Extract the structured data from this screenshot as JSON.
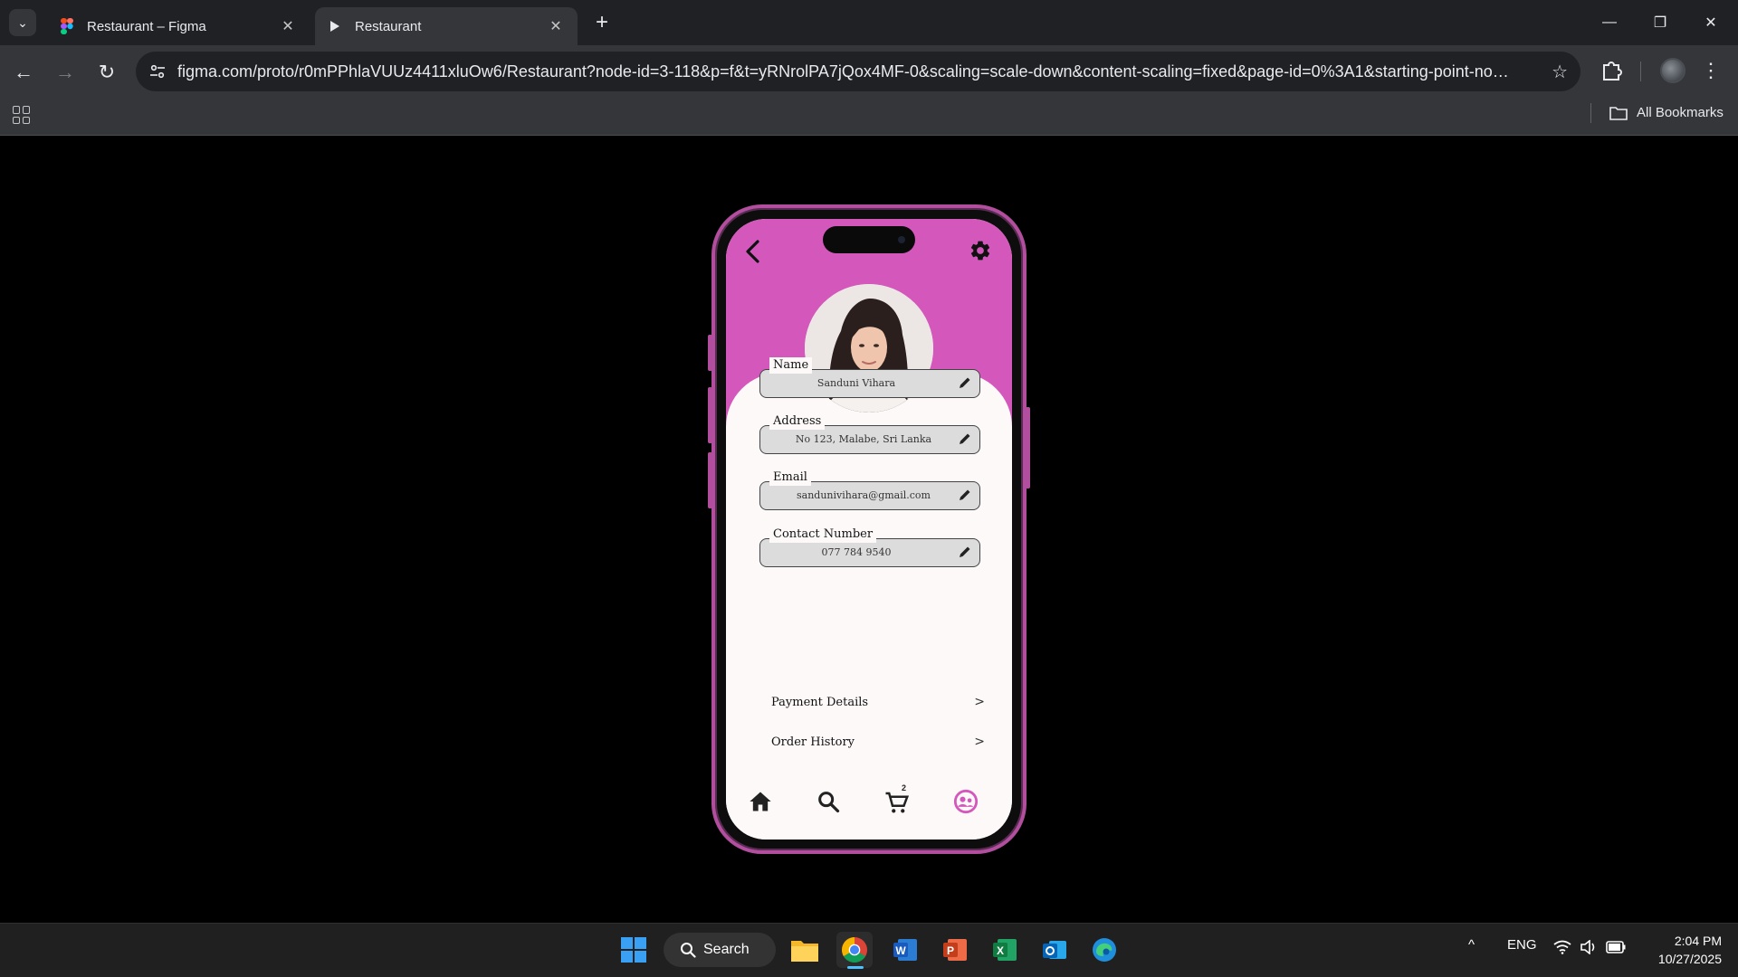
{
  "browser": {
    "tabs": [
      {
        "label": "Restaurant – Figma",
        "favicon": "figma-icon"
      },
      {
        "label": "Restaurant",
        "favicon": "play-icon",
        "active": true
      }
    ],
    "url": "figma.com/proto/r0mPPhlaVUUz4411xluOw6/Restaurant?node-id=3-118&p=f&t=yRNrolPA7jQox4MF-0&scaling=scale-down&content-scaling=fixed&page-id=0%3A1&starting-point-node-i...",
    "bookmarks_label": "All Bookmarks"
  },
  "profile_screen": {
    "accent_color": "#d458bc",
    "fields": [
      {
        "label": "Name",
        "value": "Sanduni Vihara"
      },
      {
        "label": "Address",
        "value": "No 123, Malabe, Sri Lanka"
      },
      {
        "label": "Email",
        "value": "sanduniviharа@gmail.com"
      },
      {
        "label": "Contact Number",
        "value": "077 784 9540"
      }
    ],
    "menu": [
      {
        "label": "Payment Details"
      },
      {
        "label": "Order History"
      }
    ],
    "cart_count": "2",
    "bottom_nav": [
      "home-icon",
      "search-icon",
      "cart-icon",
      "profile-icon"
    ]
  },
  "taskbar": {
    "search_label": "Search",
    "language": "ENG",
    "time": "2:04 PM",
    "date": "10/27/2025"
  }
}
